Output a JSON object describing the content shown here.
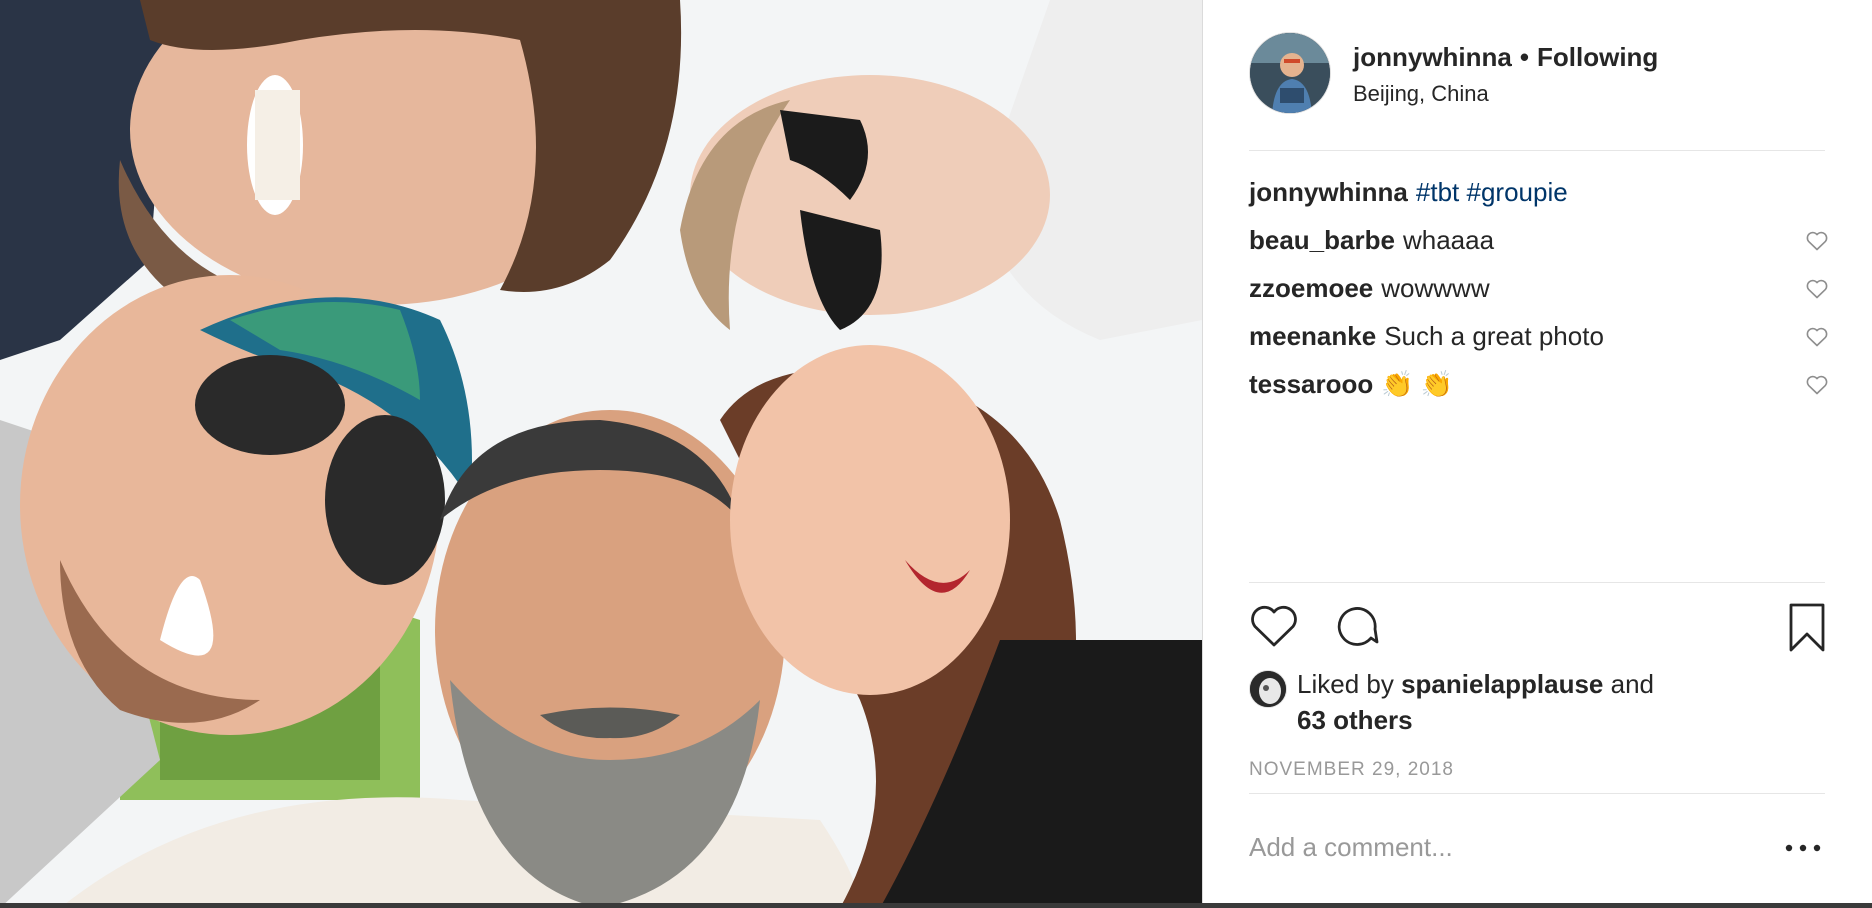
{
  "post": {
    "username": "jonnywhinna",
    "separator": "•",
    "follow_status": "Following",
    "location": "Beijing, China"
  },
  "caption": {
    "username": "jonnywhinna",
    "hashtags": [
      "#tbt",
      "#groupie"
    ]
  },
  "comments": [
    {
      "username": "beau_barbe",
      "text": "whaaaa"
    },
    {
      "username": "zzoemoee",
      "text": "wowwww"
    },
    {
      "username": "meenanke",
      "text": "Such a great photo"
    },
    {
      "username": "tessarooo",
      "text": "👏 👏"
    }
  ],
  "actions": {
    "like_icon": "heart-icon",
    "comment_icon": "comment-bubble-icon",
    "save_icon": "bookmark-icon"
  },
  "likes": {
    "prefix": "Liked by",
    "user": "spanielapplause",
    "joiner": "and",
    "others": "63 others"
  },
  "date": "NOVEMBER 29, 2018",
  "comment_input": {
    "placeholder": "Add a comment..."
  },
  "more_icon": "more-options-icon",
  "colors": {
    "hashtag": "#003569",
    "muted": "#999999",
    "text": "#262626",
    "divider": "#e6e6e6"
  }
}
